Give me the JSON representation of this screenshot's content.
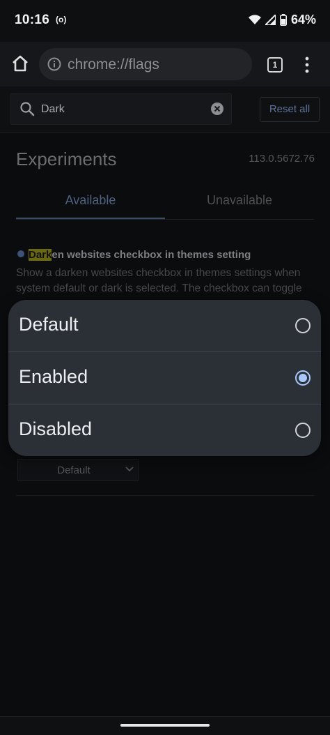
{
  "status_bar": {
    "time": "10:16",
    "hotspot_indicator": "(o)",
    "battery_percent": "64%",
    "icons": [
      "wifi-icon",
      "signal-icon",
      "battery-icon"
    ]
  },
  "toolbar": {
    "url": "chrome://flags",
    "tab_count": "1",
    "icons": [
      "home-icon",
      "info-icon",
      "tab-switcher-icon",
      "more-vert-icon"
    ]
  },
  "search": {
    "value": "Dark",
    "reset_label": "Reset all"
  },
  "page": {
    "title": "Experiments",
    "version": "113.0.5672.76",
    "tabs": [
      {
        "label": "Available",
        "selected": true
      },
      {
        "label": "Unavailable",
        "selected": false
      }
    ]
  },
  "flag": {
    "title_highlight": "Dark",
    "title_rest": "en websites checkbox in themes setting",
    "description_line1": "Show a darken websites checkbox in themes settings when",
    "description_line2": "system default or dark is selected. The checkbox can toggle",
    "select_value": "Default"
  },
  "dialog": {
    "options": [
      {
        "label": "Default",
        "checked": false
      },
      {
        "label": "Enabled",
        "checked": true
      },
      {
        "label": "Disabled",
        "checked": false
      }
    ]
  },
  "colors": {
    "accent": "#a9c7ff",
    "dialog_bg": "#2b2f36",
    "highlight": "#6b6a10"
  }
}
